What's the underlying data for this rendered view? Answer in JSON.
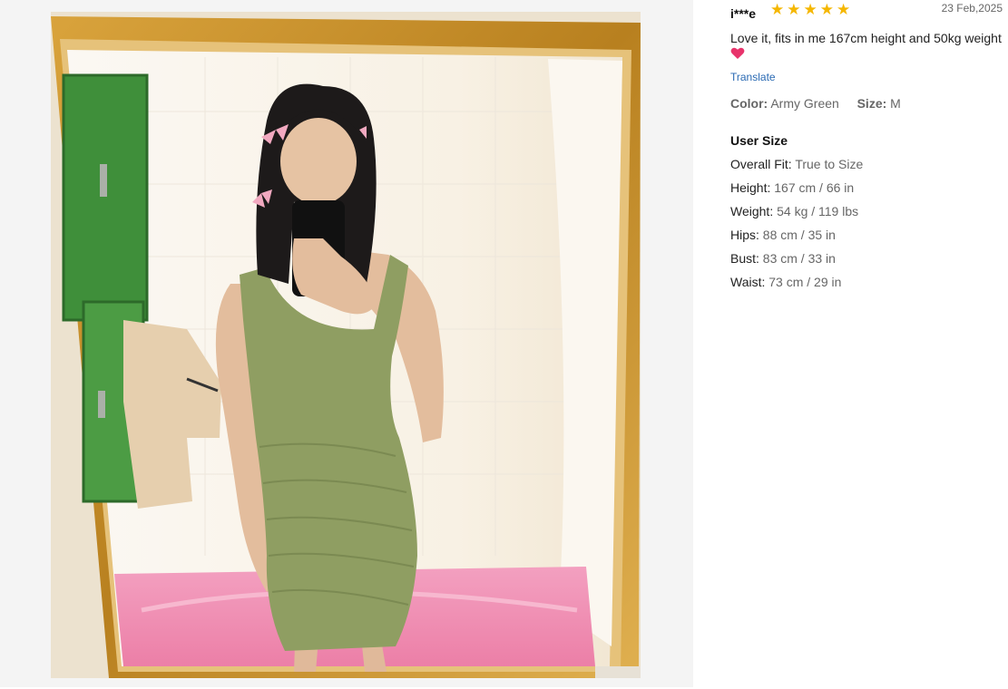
{
  "review": {
    "user": "i***e",
    "rating": 5,
    "date": "23 Feb,2025",
    "comment": "Love it, fits in me 167cm height and 50kg weight",
    "translate_label": "Translate",
    "color_label": "Color:",
    "color_value": "Army Green",
    "size_label": "Size:",
    "size_value": "M",
    "user_size_title": "User Size",
    "user_size": [
      {
        "label": "Overall Fit:",
        "value": "True to Size"
      },
      {
        "label": "Height:",
        "value": "167 cm / 66 in"
      },
      {
        "label": "Weight:",
        "value": "54 kg / 119 lbs"
      },
      {
        "label": "Hips:",
        "value": "88 cm / 35 in"
      },
      {
        "label": "Bust:",
        "value": "83 cm / 33 in"
      },
      {
        "label": "Waist:",
        "value": "73 cm / 29 in"
      }
    ]
  },
  "colors": {
    "star": "#f5b700",
    "heart": "#e8336b",
    "link": "#2a6ab3",
    "dress": "#8f9e62",
    "frame": "#c8902c"
  }
}
